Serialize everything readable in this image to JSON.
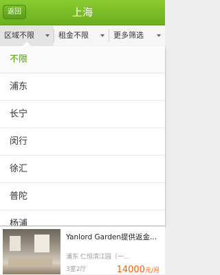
{
  "header": {
    "back_label": "返回",
    "title": "上海"
  },
  "filters": [
    {
      "label": "区域不限"
    },
    {
      "label": "租金不限"
    },
    {
      "label": "更多筛选"
    }
  ],
  "district_options": [
    {
      "label": "不限",
      "selected": true
    },
    {
      "label": "浦东"
    },
    {
      "label": "长宁"
    },
    {
      "label": "闵行"
    },
    {
      "label": "徐汇"
    },
    {
      "label": "普陀"
    },
    {
      "label": "杨浦"
    }
  ],
  "listing": {
    "title": "Yanlord Garden提供返金...",
    "location": "浦东  仁恒滨江园（一...",
    "layout": "3室2厅",
    "price": "14000",
    "price_unit": "元/月"
  },
  "colors": {
    "accent": "#6aae1d",
    "price": "#ff5a00"
  }
}
